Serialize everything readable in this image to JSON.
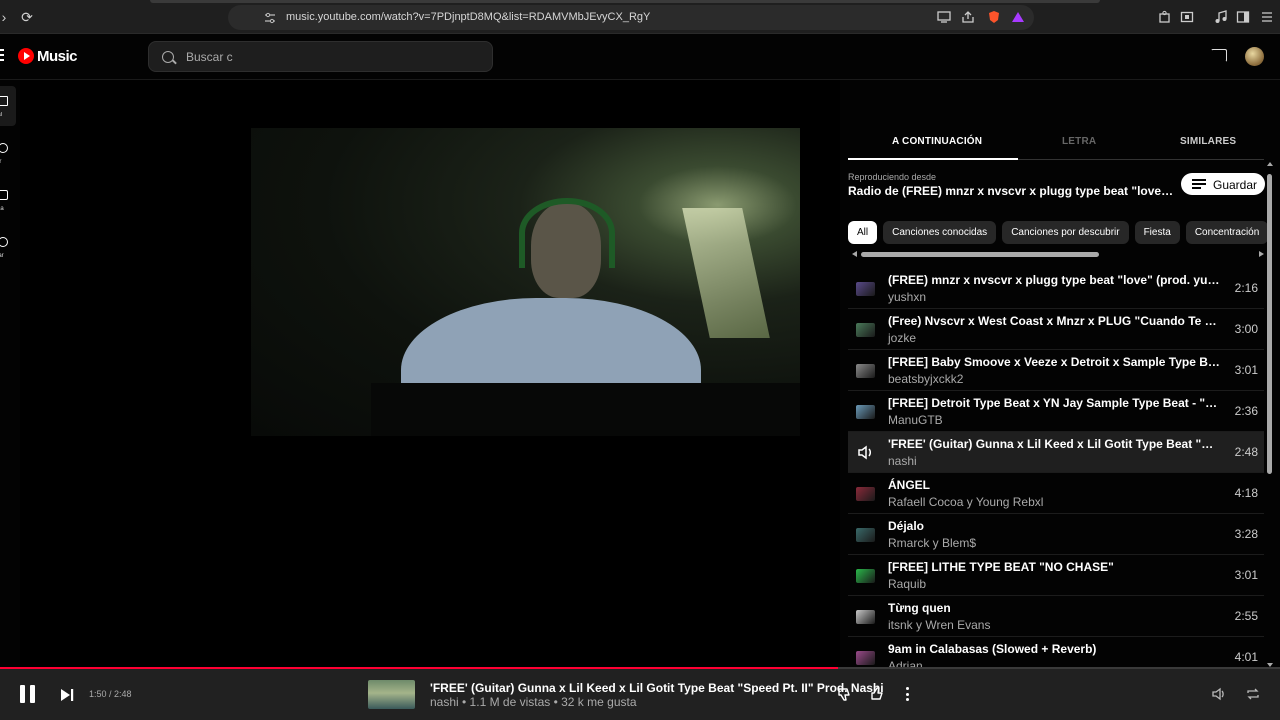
{
  "browser": {
    "url": "music.youtube.com/watch?v=7PDjnptD8MQ&list=RDAMVMbJEvyCX_RgY"
  },
  "header": {
    "logo_text": "Music",
    "search_placeholder": "Buscar c"
  },
  "sidebar": {
    "items": [
      {
        "label": "pal",
        "icon": "home-icon"
      },
      {
        "label": "rar",
        "icon": "explore-icon"
      },
      {
        "label": "eca",
        "icon": "library-icon"
      },
      {
        "label": "izar",
        "icon": "upgrade-icon"
      }
    ]
  },
  "panel": {
    "tabs": [
      "A CONTINUACIÓN",
      "LETRA",
      "SIMILARES"
    ],
    "playing_from_label": "Reproduciendo desde",
    "playlist_title": "Radio de (FREE) mnzr x nvscvr x plugg type beat \"love\" (prod. yushxn)",
    "save_label": "Guardar",
    "chips": [
      "All",
      "Canciones conocidas",
      "Canciones por descubrir",
      "Fiesta",
      "Concentración"
    ]
  },
  "queue": [
    {
      "title": "(FREE) mnzr x nvscvr x plugg type beat \"love\" (prod. yushxn)",
      "artist": "yushxn",
      "duration": "2:16",
      "thumb_color": "#5a4a8a"
    },
    {
      "title": "(Free) Nvscvr x West Coast x Mnzr x PLUG \"Cuando Te Toque\" | Prod. jozke",
      "artist": "jozke",
      "duration": "3:00",
      "thumb_color": "#4a7a5a"
    },
    {
      "title": "[FREE] Baby Smoove x Veeze x Detroit x Sample Type Beat \"Blue Eyes\"",
      "artist": "beatsbyjxckk2",
      "duration": "3:01",
      "thumb_color": "#8a8a8a"
    },
    {
      "title": "[FREE] Detroit Type Beat x YN Jay Sample Type Beat - \"Rio De Janeiro\"",
      "artist": "ManuGTB",
      "duration": "2:36",
      "thumb_color": "#6a9ab8"
    },
    {
      "title": "'FREE' (Guitar) Gunna x Lil Keed x Lil Gotit Type Beat \"Speed Pt. II\" Prod. Nashi",
      "artist": "nashi",
      "duration": "2:48",
      "playing": true
    },
    {
      "title": "ÁNGEL",
      "artist": "Rafaell Cocoa y Young Rebxl",
      "duration": "4:18",
      "thumb_color": "#8a2a3a"
    },
    {
      "title": "Déjalo",
      "artist": "Rmarck y Blem$",
      "duration": "3:28",
      "thumb_color": "#3a6a6a"
    },
    {
      "title": "[FREE] LITHE TYPE BEAT \"NO CHASE\"",
      "artist": "Raquib",
      "duration": "3:01",
      "thumb_color": "#2ab84a"
    },
    {
      "title": "Từng quen",
      "artist": "itsnk y Wren Evans",
      "duration": "2:55",
      "thumb_color": "#c8c8c8"
    },
    {
      "title": "9am in Calabasas (Slowed + Reverb)",
      "artist": "Adrian",
      "duration": "4:01",
      "thumb_color": "#9a4a8a"
    }
  ],
  "player": {
    "time": "1:50 / 2:48",
    "progress": 0.655,
    "title": "'FREE' (Guitar) Gunna x Lil Keed x Lil Gotit Type Beat \"Speed Pt. II\" Prod. Nashi",
    "subtitle": "nashi • 1.1 M de vistas • 32 k me gusta",
    "accent": "#ff0033"
  }
}
